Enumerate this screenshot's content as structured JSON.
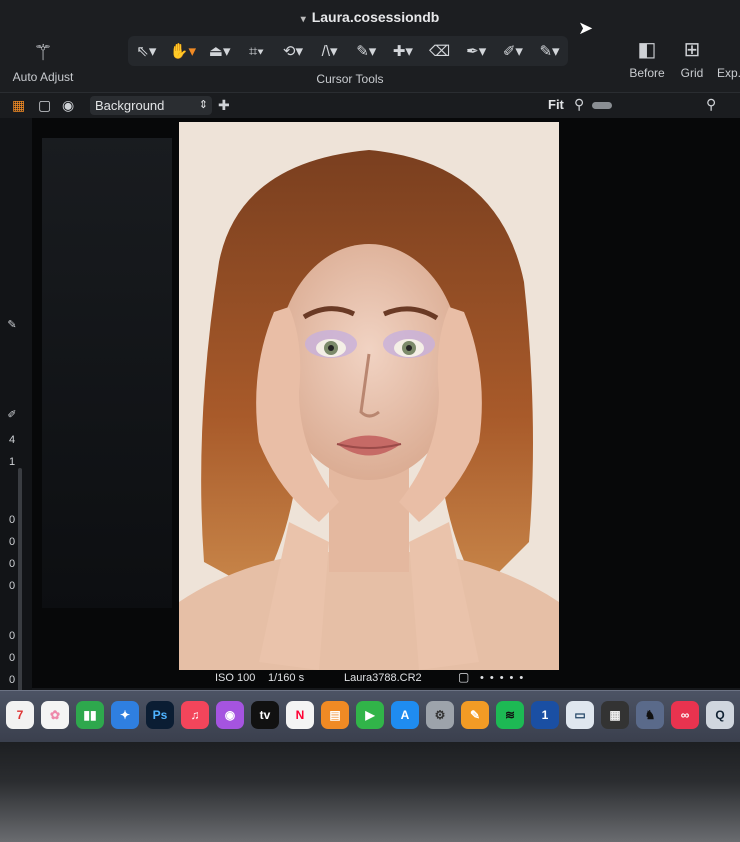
{
  "window": {
    "title": "Laura.cosessiondb"
  },
  "toolbar": {
    "auto_adjust_label": "Auto Adjust",
    "cursor_tools_label": "Cursor Tools",
    "tools": [
      {
        "name": "select-tool",
        "glyph": "⇖▾",
        "active": false
      },
      {
        "name": "pan-tool",
        "glyph": "✋▾",
        "active": true
      },
      {
        "name": "eraser-tool",
        "glyph": "⏏▾",
        "active": false
      },
      {
        "name": "crop-tool",
        "glyph": "⌗▾",
        "active": false
      },
      {
        "name": "rotate-tool",
        "glyph": "⟲▾",
        "active": false
      },
      {
        "name": "keystone-tool",
        "glyph": "/\\▾",
        "active": false
      },
      {
        "name": "brush-tool",
        "glyph": "✎▾",
        "active": false
      },
      {
        "name": "heal-tool",
        "glyph": "✚▾",
        "active": false
      },
      {
        "name": "erase-tool",
        "glyph": "⌫",
        "active": false
      },
      {
        "name": "picker-tool",
        "glyph": "✒▾",
        "active": false
      },
      {
        "name": "annotate-tool",
        "glyph": "✐▾",
        "active": false
      },
      {
        "name": "pen-tool",
        "glyph": "✎▾",
        "active": false
      }
    ],
    "before_label": "Before",
    "grid_label": "Grid",
    "export_label": "Exp."
  },
  "subbar": {
    "layer_value": "Background",
    "fit_label": "Fit"
  },
  "left_strip": {
    "values": [
      "4",
      "1",
      "0",
      "0",
      "0",
      "0",
      "0",
      "0",
      "0",
      "0"
    ]
  },
  "infobar": {
    "iso": "ISO 100",
    "shutter": "1/160 s",
    "filename": "Laura3788.CR2"
  },
  "dock": {
    "apps": [
      {
        "name": "calendar-icon",
        "label": "7",
        "color": "#f2f2f2",
        "text": "#d33"
      },
      {
        "name": "photos-icon",
        "label": "✿",
        "color": "#f4f4f4",
        "text": "#e8a"
      },
      {
        "name": "numbers-icon",
        "label": "▮▮",
        "color": "#2ea84d",
        "text": "#fff"
      },
      {
        "name": "keynote-icon",
        "label": "✦",
        "color": "#2f7fe0",
        "text": "#fff"
      },
      {
        "name": "photoshop-icon",
        "label": "Ps",
        "color": "#0b1d33",
        "text": "#4fb3ff"
      },
      {
        "name": "music-icon",
        "label": "♫",
        "color": "#f3455b",
        "text": "#fff"
      },
      {
        "name": "podcasts-icon",
        "label": "◉",
        "color": "#a554e0",
        "text": "#fff"
      },
      {
        "name": "appletv-icon",
        "label": "tv",
        "color": "#111",
        "text": "#fff"
      },
      {
        "name": "news-icon",
        "label": "N",
        "color": "#f4f4f4",
        "text": "#f03"
      },
      {
        "name": "books-icon",
        "label": "▤",
        "color": "#f08a24",
        "text": "#fff"
      },
      {
        "name": "facetime-icon",
        "label": "▶",
        "color": "#31b449",
        "text": "#fff"
      },
      {
        "name": "appstore-icon",
        "label": "A",
        "color": "#1f8cf0",
        "text": "#fff"
      },
      {
        "name": "system-settings-icon",
        "label": "⚙",
        "color": "#9da3ab",
        "text": "#333"
      },
      {
        "name": "pages-icon",
        "label": "✎",
        "color": "#f29b25",
        "text": "#fff"
      },
      {
        "name": "spotify-icon",
        "label": "≋",
        "color": "#1db954",
        "text": "#111"
      },
      {
        "name": "onepassword-icon",
        "label": "1",
        "color": "#1a4fa3",
        "text": "#fff"
      },
      {
        "name": "preview-icon",
        "label": "▭",
        "color": "#dfe6ef",
        "text": "#246"
      },
      {
        "name": "calculator-icon",
        "label": "▦",
        "color": "#333",
        "text": "#eee"
      },
      {
        "name": "dragon-app-icon",
        "label": "♞",
        "color": "#5a6a8a",
        "text": "#111"
      },
      {
        "name": "creative-cloud-icon",
        "label": "∞",
        "color": "#e8334f",
        "text": "#fff"
      },
      {
        "name": "quicktime-icon",
        "label": "Q",
        "color": "#d0d6de",
        "text": "#123"
      }
    ]
  }
}
